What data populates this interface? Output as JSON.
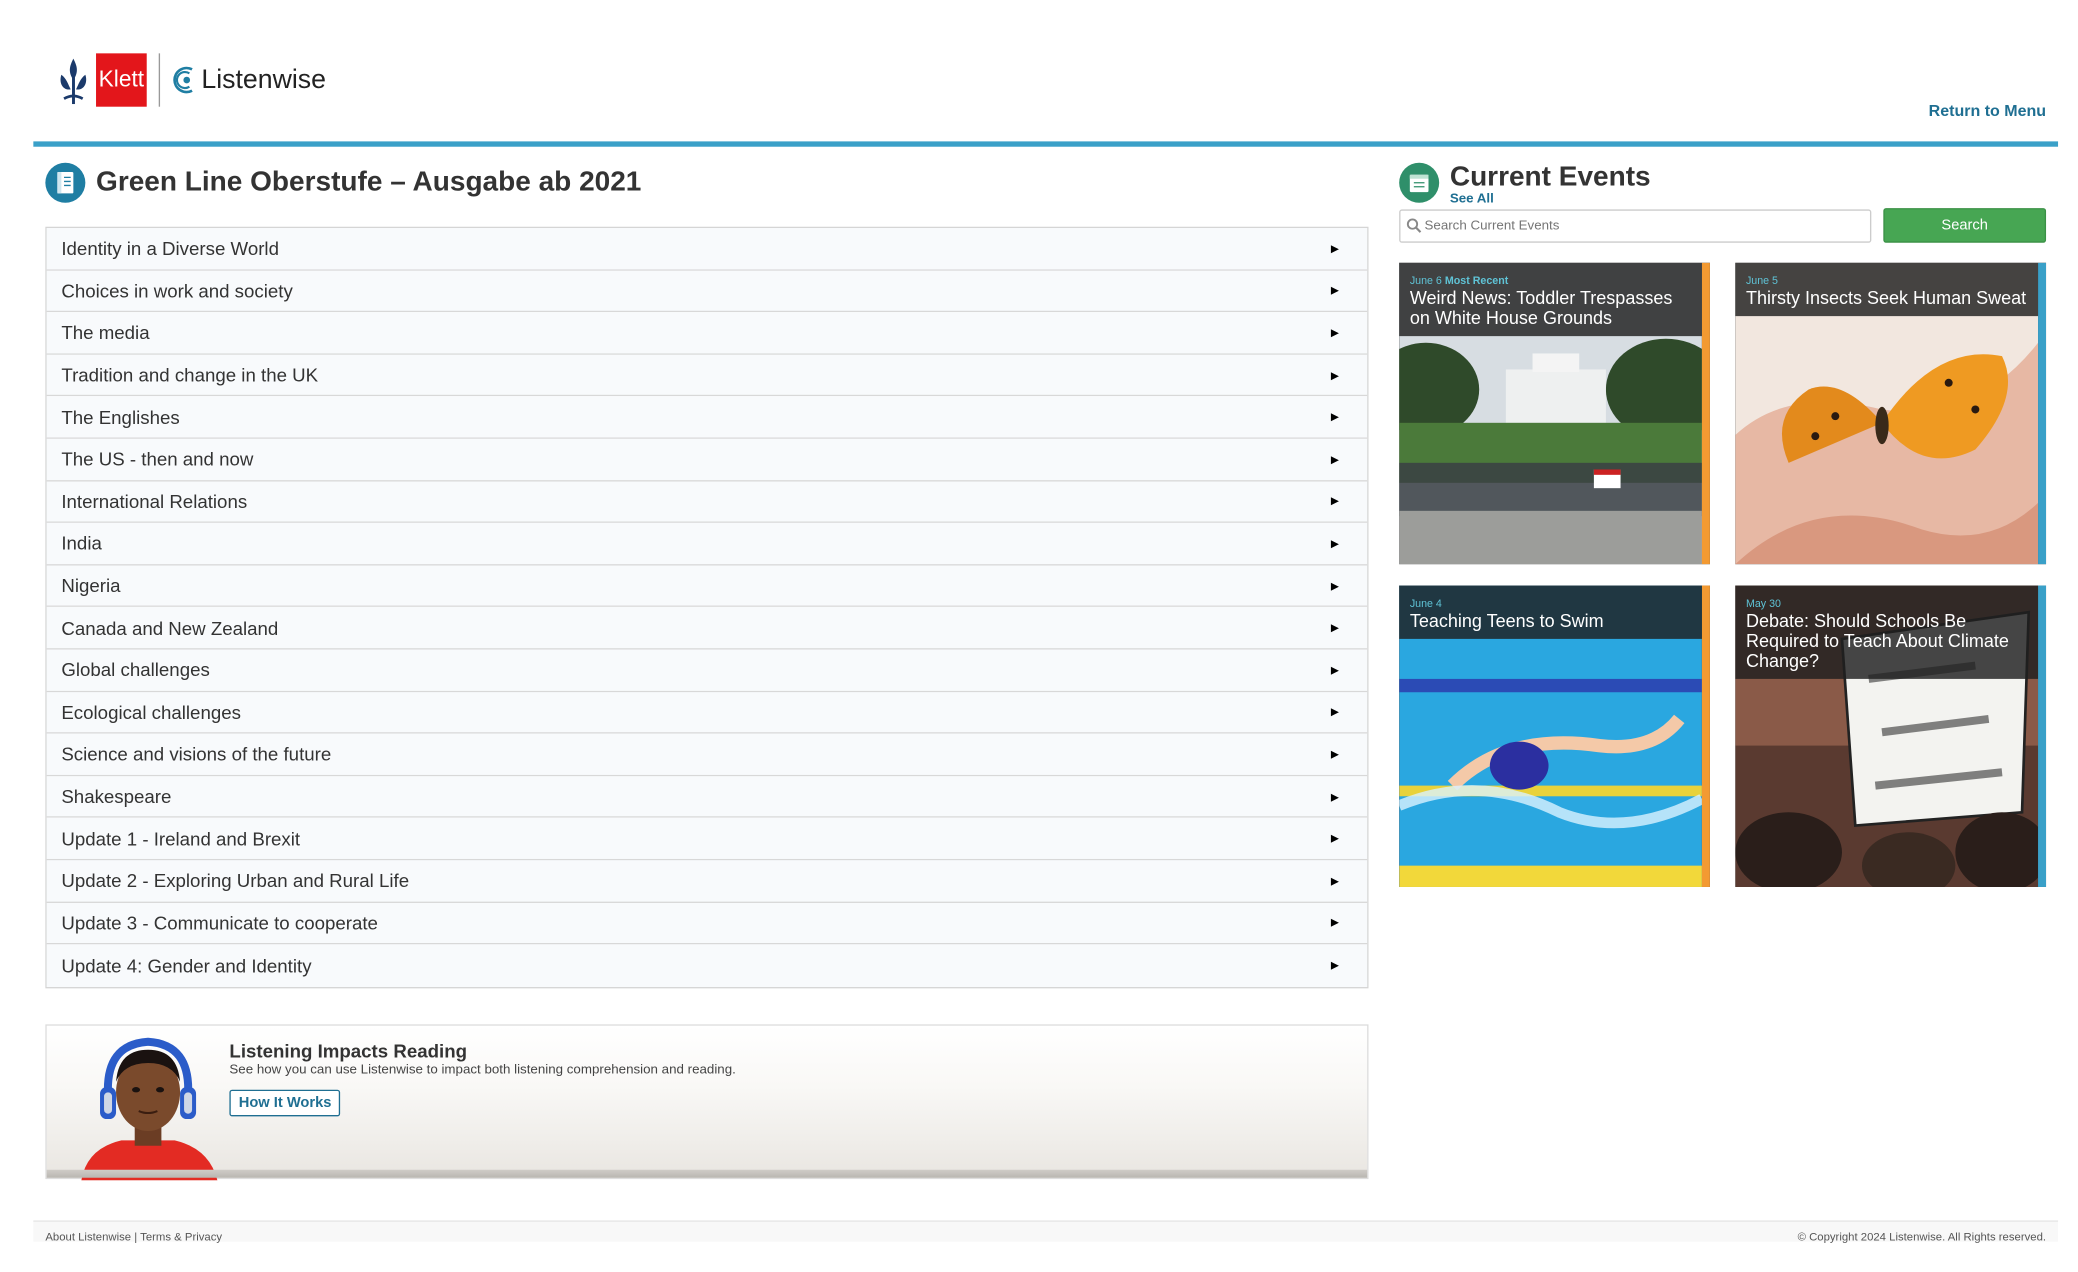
{
  "header": {
    "klett_logo_text": "Klett",
    "listenwise_logo_text": "Listenwise",
    "return_link": "Return to Menu"
  },
  "collection": {
    "title": "Green Line Oberstufe – Ausgabe ab 2021",
    "units": [
      "Identity in a Diverse World",
      "Choices in work and society",
      "The media",
      "Tradition and change in the UK",
      "The Englishes",
      "The US - then and now",
      "International Relations",
      "India",
      "Nigeria",
      "Canada and New Zealand",
      "Global challenges",
      "Ecological challenges",
      "Science and visions of the future",
      "Shakespeare",
      "Update 1 - Ireland and Brexit",
      "Update 2 - Exploring Urban and Rural Life",
      "Update 3 - Communicate to cooperate",
      "Update 4: Gender and Identity"
    ],
    "expand_glyph": "▶"
  },
  "promo": {
    "title": "Listening Impacts Reading",
    "subtitle": "See how you can use Listenwise to impact both listening comprehension and reading.",
    "button": "How It Works"
  },
  "current_events": {
    "title": "Current Events",
    "see_all": "See All",
    "search_placeholder": "Search Current Events",
    "search_button": "Search",
    "cards": [
      {
        "date": "June 6",
        "badge": "Most Recent",
        "title": "Weird News: Toddler Trespasses on White House Grounds",
        "accent": "#f39a32",
        "image": "white-house-fence"
      },
      {
        "date": "June 5",
        "badge": "",
        "title": "Thirsty Insects Seek Human Sweat",
        "accent": "#3aa0c8",
        "image": "butterfly-on-hand"
      },
      {
        "date": "June 4",
        "badge": "",
        "title": "Teaching Teens to Swim",
        "accent": "#f39a32",
        "image": "swimmer-in-pool"
      },
      {
        "date": "May 30",
        "badge": "",
        "title": "Debate: Should Schools Be Required to Teach About Climate Change?",
        "accent": "#3aa0c8",
        "image": "protest-sign"
      }
    ]
  },
  "footer": {
    "about": "About Listenwise",
    "separator": "|",
    "terms": "Terms & Privacy",
    "copyright": "© Copyright 2024 Listenwise. All Rights reserved."
  }
}
